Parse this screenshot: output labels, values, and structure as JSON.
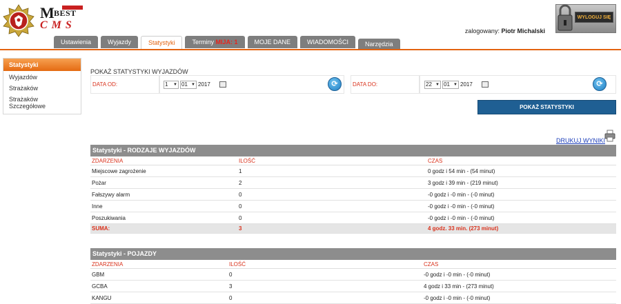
{
  "header": {
    "logo": {
      "m": "M",
      "best": "BEST",
      "cms": "CMS"
    },
    "user_label": "zalogowany:",
    "user_name": "Piotr Michalski",
    "logout_label": "WYLOGUJ SIĘ"
  },
  "tabs": [
    {
      "label": "Ustawienia"
    },
    {
      "label": "Wyjazdy"
    },
    {
      "label": "Statystyki",
      "active": true
    },
    {
      "label": "Terminy",
      "badge": "MIJA: 1"
    },
    {
      "label": "MOJE DANE"
    },
    {
      "label": "WIADOMOŚCI"
    },
    {
      "label": "Narzędzia"
    }
  ],
  "sidebar": {
    "title": "Statystyki",
    "items": [
      {
        "label": "Wyjazdów"
      },
      {
        "label": "Strażaków"
      },
      {
        "label": "Strażaków Szczegółowe"
      }
    ]
  },
  "filter": {
    "title": "POKAŻ STATYSTYKI WYJAZDÓW",
    "from_label": "DATA OD:",
    "from_day": "1",
    "from_month": "01",
    "from_year": "2017",
    "to_label": "DATA DO:",
    "to_day": "22",
    "to_month": "01",
    "to_year": "2017",
    "show_button": "POKAŻ STATYSTYKI",
    "print_link": "DRUKUJ WYNIKI"
  },
  "table1": {
    "title": "Statystyki - RODZAJE WYJAZDÓW",
    "headers": [
      "ZDARZENIA",
      "ILOŚĆ",
      "CZAS"
    ],
    "rows": [
      [
        "Miejscowe zagrożenie",
        "1",
        "0 godz i 54 min - (54 minut)"
      ],
      [
        "Pożar",
        "2",
        "3 godz i 39 min - (219 minut)"
      ],
      [
        "Fałszywy alarm",
        "0",
        "-0 godz i -0 min - (-0 minut)"
      ],
      [
        "Inne",
        "0",
        "-0 godz i -0 min - (-0 minut)"
      ],
      [
        "Poszukiwania",
        "0",
        "-0 godz i -0 min - (-0 minut)"
      ]
    ],
    "sum": [
      "SUMA:",
      "3",
      "4 godz. 33 min. (273 minut)"
    ]
  },
  "table2": {
    "title": "Statystyki - POJAZDY",
    "headers": [
      "ZDARZENIA",
      "ILOŚĆ",
      "CZAS"
    ],
    "rows": [
      [
        "GBM",
        "0",
        "-0 godz i -0 min - (-0 minut)"
      ],
      [
        "GCBA",
        "3",
        "4 godz i 33 min - (273 minut)"
      ],
      [
        "KANGU",
        "0",
        "-0 godz i -0 min - (-0 minut)"
      ]
    ]
  }
}
